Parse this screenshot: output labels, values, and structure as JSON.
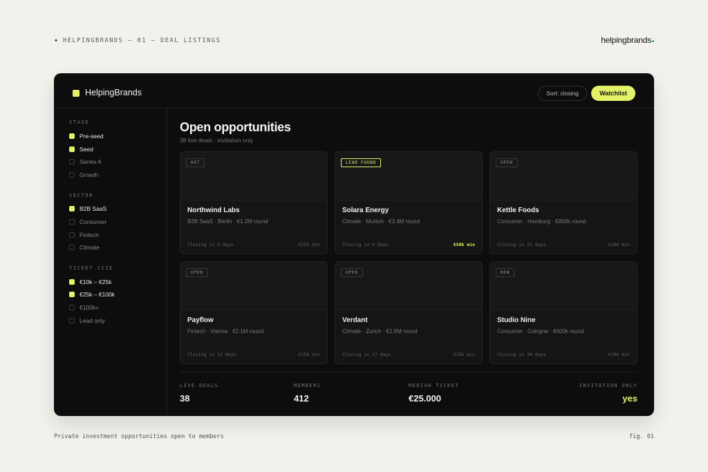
{
  "page": {
    "top_caption": "HELPINGBRANDS — 01 — DEAL LISTINGS",
    "brand": "helpingbrands",
    "bottom_caption": "Private investment opportunities open to members",
    "fig": "fig. 01"
  },
  "header": {
    "logo_text": "HelpingBrands",
    "sort_label": "Sort: closing",
    "watchlist_label": "Watchlist"
  },
  "sidebar": {
    "sections": [
      {
        "title": "STAGE",
        "items": [
          {
            "label": "Pre-seed",
            "checked": true
          },
          {
            "label": "Seed",
            "checked": true
          },
          {
            "label": "Series A",
            "checked": false
          },
          {
            "label": "Growth",
            "checked": false
          }
        ]
      },
      {
        "title": "SECTOR",
        "items": [
          {
            "label": "B2B SaaS",
            "checked": true
          },
          {
            "label": "Consumer",
            "checked": false
          },
          {
            "label": "Fintech",
            "checked": false
          },
          {
            "label": "Climate",
            "checked": false
          }
        ]
      },
      {
        "title": "TICKET SIZE",
        "items": [
          {
            "label": "€10k – €25k",
            "checked": true
          },
          {
            "label": "€25k – €100k",
            "checked": true
          },
          {
            "label": "€100k+",
            "checked": false
          },
          {
            "label": "Lead only",
            "checked": false
          }
        ]
      }
    ]
  },
  "main": {
    "title": "Open opportunities",
    "subtitle": "38 live deals · invitation only",
    "cards": [
      {
        "badge": "HOT",
        "name": "Northwind Labs",
        "meta": "B2B SaaS · Berlin · €1.2M round",
        "closing": "Closing in 9 days",
        "min": "€25k min",
        "accent": false
      },
      {
        "badge": "LEAD FOUND",
        "name": "Solara Energy",
        "meta": "Climate · Munich · €3.4M round",
        "closing": "Closing in 4 days",
        "min": "€50k min",
        "accent": true
      },
      {
        "badge": "OPEN",
        "name": "Kettle Foods",
        "meta": "Consumer · Hamburg · €800k round",
        "closing": "Closing in 21 days",
        "min": "€10k min",
        "accent": false
      },
      {
        "badge": "OPEN",
        "name": "Payflow",
        "meta": "Fintech · Vienna · €2.1M round",
        "closing": "Closing in 12 days",
        "min": "€25k min",
        "accent": false
      },
      {
        "badge": "OPEN",
        "name": "Verdant",
        "meta": "Climate · Zurich · €1.6M round",
        "closing": "Closing in 17 days",
        "min": "€25k min",
        "accent": false
      },
      {
        "badge": "NEW",
        "name": "Studio Nine",
        "meta": "Consumer · Cologne · €600k round",
        "closing": "Closing in 30 days",
        "min": "€10k min",
        "accent": false
      }
    ]
  },
  "stats": [
    {
      "label": "LIVE DEALS",
      "value": "38"
    },
    {
      "label": "MEMBERS",
      "value": "412"
    },
    {
      "label": "MEDIAN TICKET",
      "value": "€25.000"
    },
    {
      "label": "INVITATION ONLY",
      "value": "yes"
    }
  ],
  "colors": {
    "accent": "#e4f26a",
    "panel": "#0d0d0d",
    "page": "#f3f1ec"
  }
}
